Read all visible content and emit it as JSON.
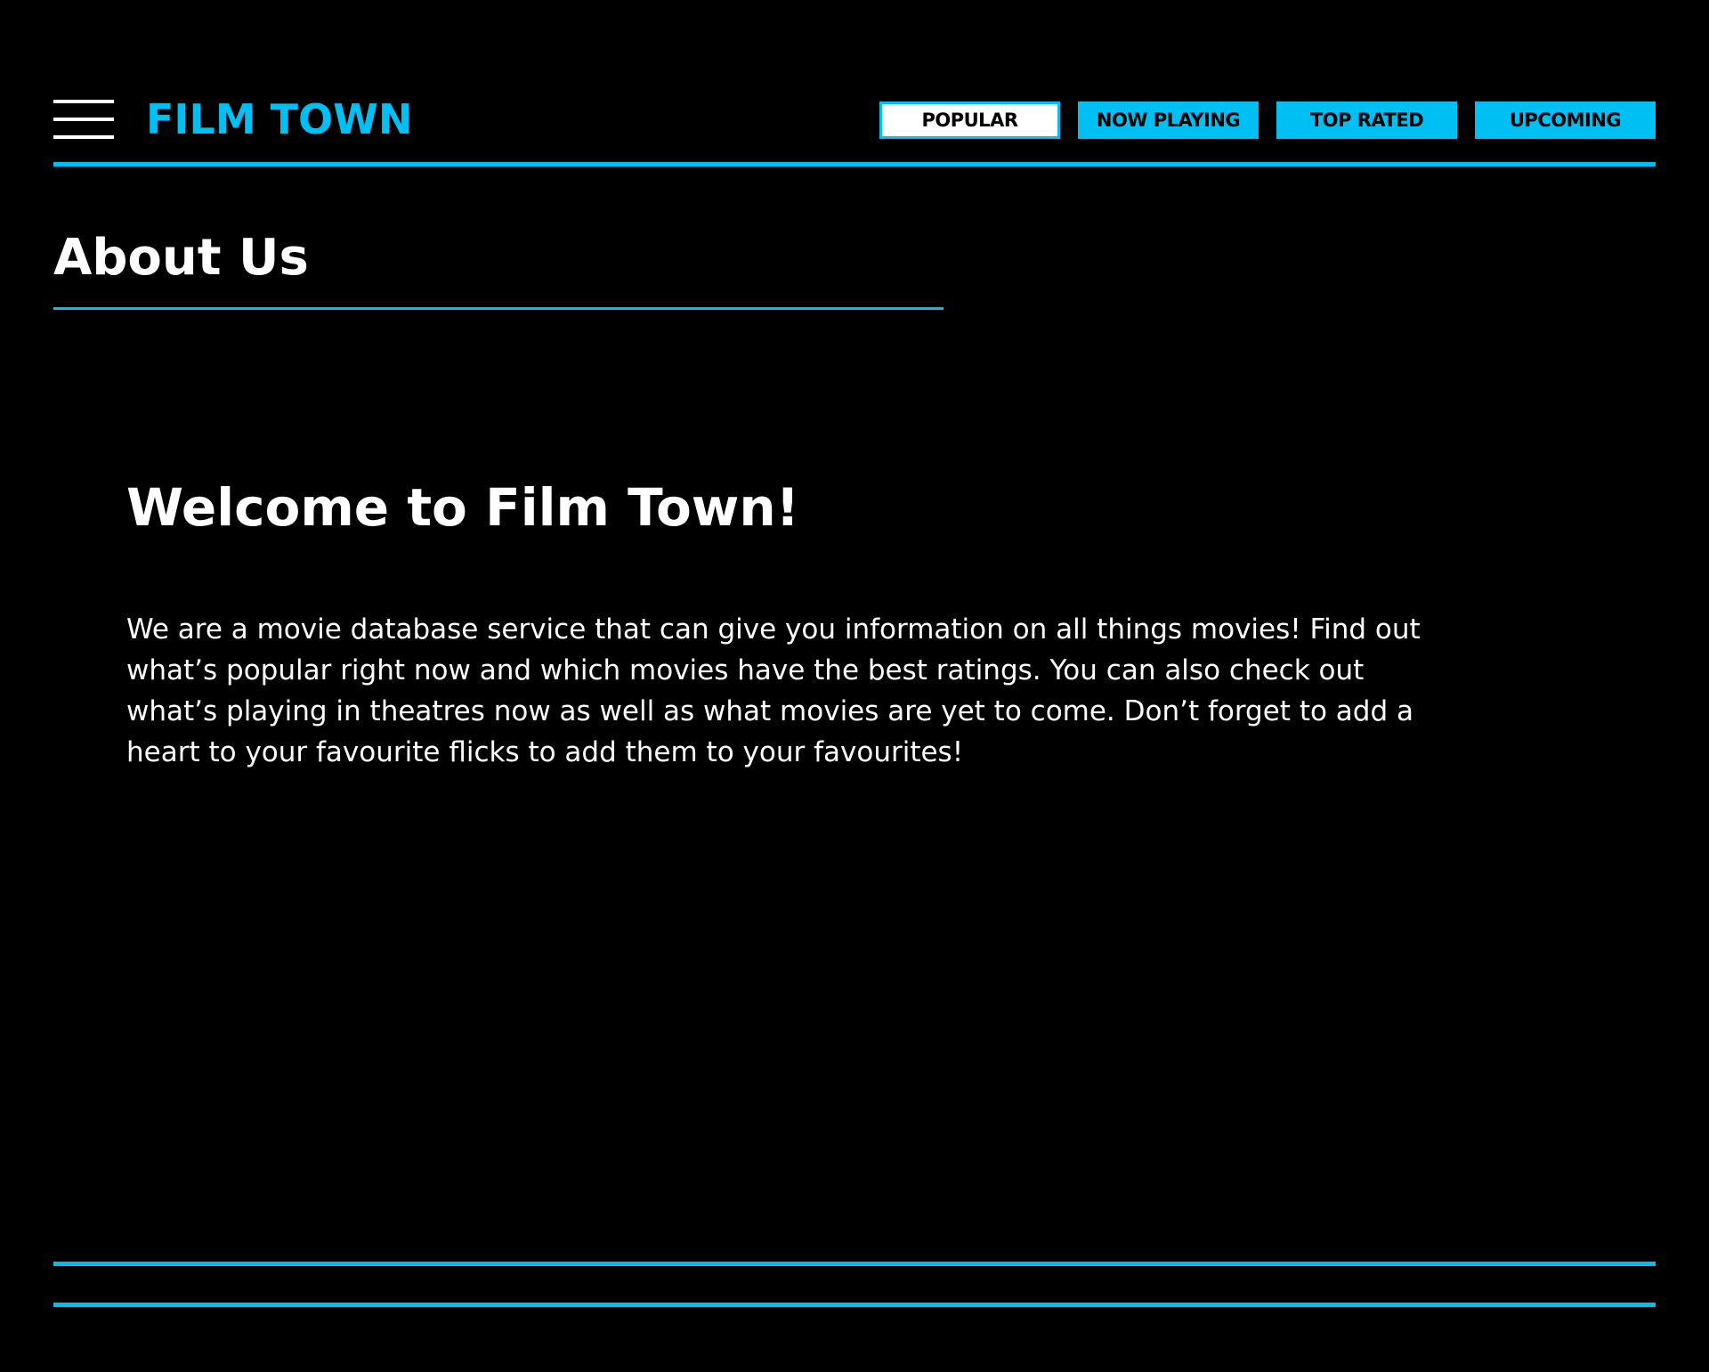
{
  "brand": {
    "name": "FILM TOWN",
    "color": "#00bff3"
  },
  "menu": {
    "icon": "hamburger-menu-icon"
  },
  "nav": {
    "items": [
      {
        "label": "POPULAR",
        "active": true
      },
      {
        "label": "NOW PLAYING",
        "active": false
      },
      {
        "label": "TOP RATED",
        "active": false
      },
      {
        "label": "UPCOMING",
        "active": false
      }
    ]
  },
  "page": {
    "title": "About Us"
  },
  "content": {
    "heading": "Welcome to Film Town!",
    "body": "We are a movie database service that can give you information on all things movies! Find out what’s popular right now and which movies have the best ratings. You can also check out what’s playing in theatres now as well as what movies are yet to come. Don’t forget to add a heart to your favourite flicks to add them to your favourites!"
  },
  "colors": {
    "background": "#000000",
    "accent": "#00bff3",
    "text": "#ffffff",
    "active_button": "#ffffff"
  }
}
